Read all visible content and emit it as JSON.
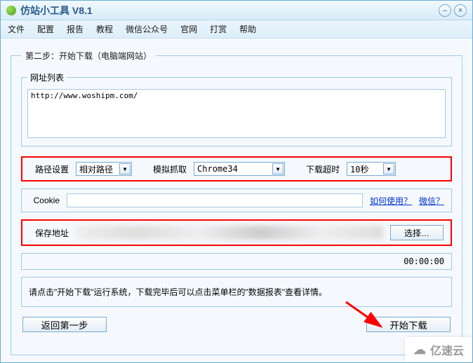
{
  "window": {
    "title": "仿站小工具 V8.1"
  },
  "menu": {
    "file": "文件",
    "config": "配置",
    "report": "报告",
    "tutorial": "教程",
    "wechat": "微信公众号",
    "official": "官网",
    "donate": "打赏",
    "help": "帮助"
  },
  "step": {
    "legend": "第二步：开始下载（电脑端网站）",
    "url_list_legend": "网址列表",
    "url_value": "http://www.woshipm.com/"
  },
  "path_row": {
    "label": "路径设置",
    "value": "相对路径",
    "crawl_label": "模拟抓取",
    "crawl_value": "Chrome34",
    "timeout_label": "下载超时",
    "timeout_value": "10秒"
  },
  "cookie_row": {
    "label": "Cookie",
    "value": "",
    "link_how": "如何使用？",
    "link_wechat": "微信？"
  },
  "save_row": {
    "label": "保存地址",
    "btn": "选择…"
  },
  "timer": "00:00:00",
  "info": "请点击\"开始下载\"运行系统，下载完毕后可以点击菜单栏的\"数据报表\"查看详情。",
  "buttons": {
    "back": "返回第一步",
    "start": "开始下载"
  },
  "watermark": "亿速云"
}
